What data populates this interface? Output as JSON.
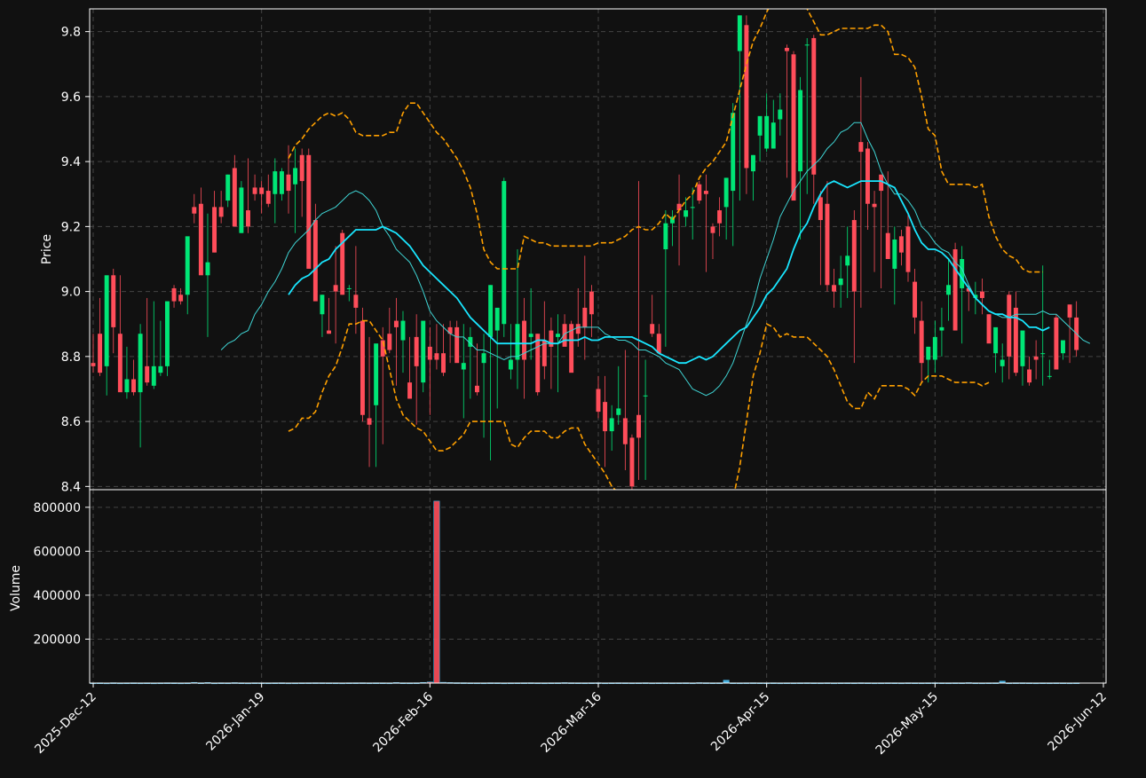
{
  "chart_data": [
    {
      "panel": "price",
      "type": "candlestick",
      "ylabel": "Price",
      "ylim": [
        8.39,
        9.87
      ],
      "yticks": [
        8.4,
        8.6,
        8.8,
        9.0,
        9.2,
        9.4,
        9.6,
        9.8
      ],
      "grid": true,
      "colors": {
        "up": "#00e676",
        "down": "#ff4d5a",
        "ma_fast": "#3fd5d5",
        "ma_slow": "#19e6ff",
        "bands": "#ffa000",
        "grid": "#444444",
        "frame": "#ffffff",
        "background": "#111111"
      },
      "candles": {
        "start_date": "2025-12-12",
        "open": [
          8.78,
          8.87,
          8.77,
          9.05,
          8.87,
          8.69,
          8.73,
          8.69,
          8.77,
          8.71,
          8.75,
          8.77,
          9.01,
          8.99,
          8.99,
          9.26,
          9.27,
          9.05,
          9.26,
          9.26,
          9.28,
          9.38,
          9.18,
          9.25,
          9.32,
          9.32,
          9.31,
          9.3,
          9.3,
          9.36,
          9.33,
          9.42,
          9.42,
          9.22,
          8.93,
          8.88,
          9.02,
          9.18,
          9.01,
          8.99,
          8.91,
          8.61,
          8.65,
          8.85,
          8.87,
          8.91,
          8.85,
          8.72,
          8.86,
          8.72,
          8.83,
          8.81,
          8.81,
          8.89,
          8.89,
          8.76,
          8.83,
          8.71,
          8.78,
          8.86,
          8.88,
          8.9,
          8.76,
          8.79,
          8.91,
          8.86,
          8.87,
          8.85,
          8.88,
          8.86,
          8.9,
          8.9,
          8.9,
          8.95,
          9.0,
          8.7,
          8.66,
          8.57,
          8.62,
          8.61,
          8.55,
          8.62,
          8.68,
          8.9,
          8.87,
          9.13,
          9.21,
          9.27,
          9.23,
          9.26,
          9.33,
          9.31,
          9.2,
          9.25,
          9.26,
          9.31,
          9.74,
          9.82,
          9.37,
          9.48,
          9.44,
          9.44,
          9.53,
          9.75,
          9.73,
          9.37,
          9.76,
          9.78,
          9.29,
          9.27,
          9.02,
          9.02,
          9.08,
          9.22,
          9.46,
          9.44,
          9.27,
          9.36,
          9.18,
          9.07,
          9.17,
          9.2,
          9.03,
          8.91,
          8.79,
          8.79,
          8.88,
          8.99,
          9.13,
          9.01,
          9.01,
          8.98,
          9.0,
          8.93,
          8.81,
          8.77,
          8.99,
          8.95,
          8.77,
          8.76,
          8.8,
          8.81,
          8.74,
          8.92,
          8.81,
          8.96,
          8.92
        ],
        "high": [
          8.87,
          8.98,
          8.87,
          9.07,
          9.05,
          8.83,
          8.79,
          8.9,
          8.98,
          8.97,
          8.91,
          8.79,
          9.02,
          9.01,
          9.02,
          9.3,
          9.32,
          9.24,
          9.31,
          9.31,
          9.36,
          9.42,
          9.34,
          9.41,
          9.36,
          9.34,
          9.36,
          9.41,
          9.38,
          9.45,
          9.44,
          9.44,
          9.44,
          9.27,
          8.99,
          8.98,
          9.14,
          9.19,
          9.02,
          9.14,
          8.95,
          8.86,
          8.76,
          8.89,
          8.95,
          8.98,
          8.94,
          8.86,
          8.93,
          8.88,
          8.89,
          8.9,
          8.9,
          8.91,
          8.91,
          8.9,
          8.89,
          8.84,
          8.87,
          9.02,
          8.89,
          9.35,
          8.9,
          9.13,
          8.98,
          9.01,
          8.87,
          8.97,
          8.92,
          8.93,
          8.93,
          8.91,
          9.01,
          9.11,
          9.02,
          8.74,
          8.74,
          8.65,
          8.77,
          8.82,
          8.56,
          9.34,
          8.79,
          8.99,
          8.9,
          9.25,
          9.25,
          9.36,
          9.29,
          9.32,
          9.34,
          9.36,
          9.21,
          9.29,
          9.35,
          9.58,
          9.85,
          9.85,
          9.42,
          9.5,
          9.61,
          9.59,
          9.61,
          9.76,
          9.74,
          9.66,
          9.78,
          9.79,
          9.31,
          9.34,
          9.07,
          9.11,
          9.2,
          9.25,
          9.66,
          9.46,
          9.31,
          9.36,
          9.37,
          9.2,
          9.19,
          9.24,
          9.07,
          8.97,
          8.83,
          8.91,
          8.95,
          9.1,
          9.15,
          9.14,
          9.02,
          9.03,
          9.04,
          8.93,
          8.88,
          8.84,
          9.0,
          9.0,
          8.83,
          8.8,
          8.85,
          9.08,
          8.79,
          8.93,
          8.84,
          8.96,
          8.97
        ],
        "low": [
          8.75,
          8.74,
          8.68,
          8.81,
          8.84,
          8.67,
          8.68,
          8.52,
          8.71,
          8.7,
          8.74,
          8.74,
          8.95,
          8.96,
          8.93,
          9.21,
          9.1,
          8.86,
          9.12,
          9.21,
          9.26,
          9.3,
          9.18,
          9.18,
          9.28,
          9.24,
          9.26,
          9.21,
          9.28,
          9.24,
          9.18,
          9.23,
          9.26,
          9.1,
          8.86,
          8.87,
          8.84,
          8.99,
          8.97,
          8.87,
          8.6,
          8.46,
          8.46,
          8.53,
          8.81,
          8.71,
          8.75,
          8.71,
          8.59,
          8.69,
          8.62,
          8.76,
          8.74,
          8.78,
          8.85,
          8.61,
          8.67,
          8.68,
          8.55,
          8.48,
          8.64,
          8.86,
          8.73,
          8.7,
          8.67,
          8.79,
          8.68,
          8.73,
          8.7,
          8.69,
          8.84,
          8.86,
          8.83,
          8.79,
          8.86,
          8.61,
          8.46,
          8.51,
          8.59,
          8.45,
          8.38,
          8.42,
          8.42,
          8.86,
          8.84,
          8.83,
          9.14,
          9.08,
          9.2,
          9.16,
          9.27,
          9.06,
          9.1,
          9.17,
          9.16,
          9.14,
          9.28,
          9.3,
          9.28,
          9.4,
          9.43,
          9.44,
          9.48,
          9.35,
          9.35,
          9.16,
          9.3,
          9.27,
          9.02,
          9.0,
          8.95,
          8.95,
          8.98,
          8.78,
          8.95,
          9.19,
          9.06,
          9.01,
          9.11,
          8.96,
          9.08,
          9.03,
          8.87,
          8.72,
          8.72,
          8.75,
          8.8,
          8.91,
          8.9,
          8.84,
          8.94,
          8.93,
          8.93,
          8.88,
          8.75,
          8.72,
          8.73,
          8.74,
          8.71,
          8.71,
          8.73,
          8.71,
          8.73,
          8.78,
          8.79,
          8.78,
          8.8
        ],
        "close": [
          8.77,
          8.75,
          9.05,
          8.89,
          8.69,
          8.73,
          8.69,
          8.87,
          8.72,
          8.77,
          8.77,
          8.97,
          8.97,
          8.97,
          9.17,
          9.24,
          9.05,
          9.09,
          9.12,
          9.23,
          9.36,
          9.2,
          9.32,
          9.2,
          9.3,
          9.3,
          9.27,
          9.37,
          9.37,
          9.31,
          9.38,
          9.34,
          9.07,
          8.97,
          8.99,
          8.87,
          9.0,
          8.99,
          9.01,
          8.95,
          8.62,
          8.59,
          8.84,
          8.8,
          8.82,
          8.89,
          8.91,
          8.67,
          8.77,
          8.91,
          8.79,
          8.79,
          8.75,
          8.87,
          8.78,
          8.78,
          8.86,
          8.69,
          8.81,
          9.02,
          8.95,
          9.34,
          8.79,
          8.9,
          8.79,
          8.87,
          8.69,
          8.77,
          8.83,
          8.87,
          8.83,
          8.75,
          8.87,
          8.89,
          8.93,
          8.63,
          8.57,
          8.61,
          8.64,
          8.53,
          8.4,
          8.55,
          8.68,
          8.87,
          8.81,
          9.21,
          9.23,
          9.25,
          9.25,
          9.26,
          9.28,
          9.3,
          9.18,
          9.21,
          9.35,
          9.55,
          9.85,
          9.38,
          9.42,
          9.54,
          9.54,
          9.52,
          9.56,
          9.74,
          9.28,
          9.62,
          9.76,
          9.36,
          9.22,
          9.02,
          9.0,
          9.04,
          9.11,
          9.0,
          9.43,
          9.27,
          9.26,
          9.31,
          9.1,
          9.16,
          9.12,
          9.06,
          8.92,
          8.78,
          8.83,
          8.86,
          8.89,
          9.02,
          8.88,
          9.1,
          9.0,
          8.99,
          8.98,
          8.84,
          8.89,
          8.79,
          8.8,
          8.75,
          8.88,
          8.72,
          8.79,
          8.81,
          8.74,
          8.76,
          8.85,
          8.92,
          8.82
        ]
      },
      "ma_fast": [
        8.82,
        8.84,
        8.85,
        8.87,
        8.88,
        8.93,
        8.96,
        9.0,
        9.03,
        9.07,
        9.12,
        9.15,
        9.17,
        9.19,
        9.22,
        9.24,
        9.25,
        9.26,
        9.28,
        9.3,
        9.31,
        9.3,
        9.28,
        9.25,
        9.2,
        9.17,
        9.13,
        9.11,
        9.09,
        9.05,
        9.0,
        8.94,
        8.91,
        8.89,
        8.87,
        8.86,
        8.86,
        8.84,
        8.82,
        8.82,
        8.81,
        8.8,
        8.79,
        8.8,
        8.8,
        8.81,
        8.82,
        8.83,
        8.84,
        8.84,
        8.84,
        8.87,
        8.88,
        8.89,
        8.89,
        8.89,
        8.89,
        8.87,
        8.86,
        8.85,
        8.85,
        8.84,
        8.82,
        8.82,
        8.81,
        8.8,
        8.78,
        8.77,
        8.76,
        8.73,
        8.7,
        8.69,
        8.68,
        8.69,
        8.71,
        8.74,
        8.78,
        8.84,
        8.9,
        8.96,
        9.04,
        9.1,
        9.16,
        9.23,
        9.27,
        9.31,
        9.34,
        9.37,
        9.39,
        9.41,
        9.44,
        9.46,
        9.49,
        9.5,
        9.52,
        9.52,
        9.47,
        9.43,
        9.37,
        9.33,
        9.3,
        9.3,
        9.28,
        9.25,
        9.2,
        9.18,
        9.15,
        9.13,
        9.12,
        9.09,
        9.07,
        9.02,
        8.98,
        8.96,
        8.94,
        8.93,
        8.92,
        8.92,
        8.93,
        8.93,
        8.93,
        8.93,
        8.94,
        8.93,
        8.93,
        8.91,
        8.89,
        8.87,
        8.85,
        8.84
      ],
      "ma_fast_start": 19,
      "ma_slow": [
        8.99,
        9.02,
        9.04,
        9.05,
        9.07,
        9.09,
        9.1,
        9.13,
        9.15,
        9.17,
        9.19,
        9.19,
        9.19,
        9.19,
        9.2,
        9.19,
        9.18,
        9.16,
        9.14,
        9.11,
        9.08,
        9.06,
        9.04,
        9.02,
        9.0,
        8.98,
        8.95,
        8.92,
        8.9,
        8.88,
        8.86,
        8.84,
        8.84,
        8.84,
        8.84,
        8.84,
        8.84,
        8.85,
        8.85,
        8.84,
        8.84,
        8.85,
        8.85,
        8.85,
        8.86,
        8.85,
        8.85,
        8.86,
        8.86,
        8.86,
        8.86,
        8.86,
        8.85,
        8.84,
        8.83,
        8.81,
        8.8,
        8.79,
        8.78,
        8.78,
        8.79,
        8.8,
        8.79,
        8.8,
        8.82,
        8.84,
        8.86,
        8.88,
        8.89,
        8.92,
        8.95,
        8.99,
        9.01,
        9.04,
        9.07,
        9.13,
        9.18,
        9.21,
        9.26,
        9.3,
        9.33,
        9.34,
        9.33,
        9.32,
        9.33,
        9.34,
        9.34,
        9.34,
        9.34,
        9.33,
        9.32,
        9.28,
        9.24,
        9.19,
        9.15,
        9.13,
        9.13,
        9.12,
        9.1,
        9.07,
        9.04,
        9.01,
        8.98,
        8.96,
        8.94,
        8.93,
        8.93,
        8.92,
        8.92,
        8.91,
        8.89,
        8.89,
        8.88,
        8.89
      ],
      "ma_slow_start": 29,
      "band_upper": [
        9.41,
        9.45,
        9.47,
        9.5,
        9.52,
        9.54,
        9.55,
        9.54,
        9.55,
        9.53,
        9.49,
        9.48,
        9.48,
        9.48,
        9.48,
        9.49,
        9.49,
        9.55,
        9.58,
        9.58,
        9.55,
        9.52,
        9.49,
        9.47,
        9.44,
        9.41,
        9.37,
        9.32,
        9.24,
        9.13,
        9.09,
        9.07,
        9.07,
        9.07,
        9.07,
        9.17,
        9.16,
        9.15,
        9.15,
        9.14,
        9.14,
        9.14,
        9.14,
        9.14,
        9.14,
        9.14,
        9.15,
        9.15,
        9.15,
        9.16,
        9.17,
        9.19,
        9.2,
        9.19,
        9.19,
        9.21,
        9.24,
        9.22,
        9.25,
        9.28,
        9.3,
        9.35,
        9.38,
        9.4,
        9.43,
        9.46,
        9.54,
        9.62,
        9.7,
        9.77,
        9.81,
        9.86,
        9.9,
        9.92,
        9.92,
        9.92,
        9.91,
        9.87,
        9.83,
        9.79,
        9.79,
        9.8,
        9.81,
        9.81,
        9.81,
        9.81,
        9.81,
        9.82,
        9.82,
        9.8,
        9.73,
        9.73,
        9.72,
        9.69,
        9.6,
        9.5,
        9.48,
        9.37,
        9.33,
        9.33,
        9.33,
        9.33,
        9.32,
        9.33,
        9.23,
        9.17,
        9.13,
        9.11,
        9.1,
        9.07,
        9.06,
        9.06,
        9.06
      ],
      "band_lower": [
        8.57,
        8.58,
        8.61,
        8.61,
        8.63,
        8.69,
        8.74,
        8.77,
        8.83,
        8.9,
        8.9,
        8.91,
        8.91,
        8.88,
        8.85,
        8.76,
        8.67,
        8.62,
        8.6,
        8.58,
        8.57,
        8.54,
        8.51,
        8.51,
        8.52,
        8.54,
        8.56,
        8.6,
        8.6,
        8.6,
        8.6,
        8.6,
        8.6,
        8.53,
        8.52,
        8.55,
        8.57,
        8.57,
        8.57,
        8.55,
        8.55,
        8.57,
        8.58,
        8.58,
        8.53,
        8.5,
        8.47,
        8.44,
        8.4,
        8.38,
        8.37,
        8.35,
        8.32,
        8.29,
        8.27,
        8.25,
        8.22,
        8.2,
        8.19,
        8.17,
        8.15,
        8.16,
        8.18,
        8.2,
        8.23,
        8.26,
        8.36,
        8.46,
        8.6,
        8.74,
        8.81,
        8.9,
        8.89,
        8.86,
        8.87,
        8.86,
        8.86,
        8.86,
        8.84,
        8.82,
        8.8,
        8.76,
        8.71,
        8.66,
        8.64,
        8.64,
        8.69,
        8.67,
        8.71,
        8.71,
        8.71,
        8.71,
        8.7,
        8.68,
        8.72,
        8.74,
        8.74,
        8.74,
        8.73,
        8.72,
        8.72,
        8.72,
        8.72,
        8.71,
        8.72
      ],
      "band_start": 29
    },
    {
      "panel": "volume",
      "type": "bar",
      "ylabel": "Volume",
      "ylim": [
        0,
        880000
      ],
      "yticks": [
        200000,
        400000,
        600000,
        800000
      ],
      "ytick_labels": [
        "200000",
        "400000",
        "600000",
        "800000"
      ],
      "grid": true,
      "values": [
        1000,
        1200,
        800,
        1500,
        900,
        1100,
        1300,
        1000,
        1200,
        900,
        1100,
        1400,
        1200,
        900,
        1100,
        3000,
        1200,
        2500,
        900,
        1300,
        1100,
        2000,
        1200,
        900,
        1300,
        1100,
        1000,
        1200,
        1400,
        900,
        1000,
        1200,
        1300,
        1500,
        1400,
        1200,
        1100,
        900,
        1200,
        1300,
        1500,
        1100,
        1300,
        1200,
        1000,
        2500,
        1200,
        1100,
        1300,
        3000,
        5000,
        828000,
        3500,
        2500,
        1800,
        1600,
        1200,
        1100,
        1000,
        1400,
        1300,
        900,
        1100,
        1200,
        1300,
        1500,
        1100,
        1000,
        1200,
        1300,
        2000,
        1400,
        1200,
        1100,
        1300,
        1500,
        1000,
        1200,
        1400,
        1300,
        1100,
        1200,
        1500,
        1000,
        1200,
        1300,
        1100,
        1200,
        1400,
        1000,
        2000,
        1500,
        1200,
        1300,
        13000,
        1200,
        1100,
        1300,
        1500,
        1200,
        1100,
        1300,
        1000,
        1200,
        1100,
        1300,
        1500,
        1200,
        1100,
        1400,
        1000,
        1200,
        1300,
        1100,
        1500,
        1200,
        1000,
        1100,
        1300,
        1200,
        1000,
        1400,
        1200,
        1100,
        1300,
        1500,
        1200,
        1100,
        1300,
        1200,
        2000,
        1100,
        1000,
        1200,
        1300,
        9000,
        1100,
        1400,
        1500,
        1200,
        1000,
        1200,
        1100,
        1300,
        1200,
        1000,
        1200
      ],
      "color_up": "#4fc3f7",
      "color_down": "#ff4d5a"
    }
  ],
  "x_axis": {
    "tick_labels": [
      "2025-Dec-12",
      "2026-Jan-19",
      "2026-Feb-16",
      "2026-Mar-16",
      "2026-Apr-15",
      "2026-May-15",
      "2026-Jun-12"
    ],
    "tick_index": [
      0,
      25,
      50,
      75,
      100,
      125,
      150
    ]
  }
}
